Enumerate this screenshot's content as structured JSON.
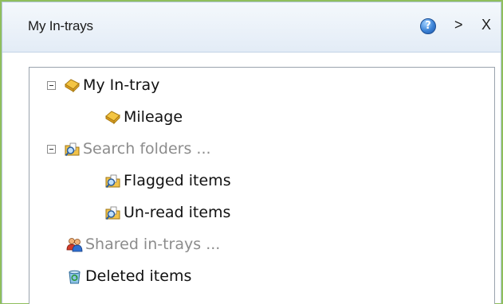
{
  "panel": {
    "title": "My In-trays",
    "help_icon_glyph": "?",
    "collapse_label": ">",
    "close_label": "X"
  },
  "tree": {
    "items": [
      {
        "label": "My In-tray",
        "icon": "tray-icon",
        "expanded": true
      },
      {
        "label": "Mileage",
        "icon": "tray-icon"
      },
      {
        "label": "Search folders ...",
        "icon": "search-folder-icon",
        "expanded": true,
        "dimmed": true
      },
      {
        "label": "Flagged items",
        "icon": "search-folder-icon"
      },
      {
        "label": "Un-read items",
        "icon": "search-folder-icon"
      },
      {
        "label": "Shared in-trays ...",
        "icon": "shared-users-icon",
        "dimmed": true
      },
      {
        "label": "Deleted items",
        "icon": "recycle-bin-icon"
      }
    ]
  },
  "colors": {
    "background_accent": "#8fbf5c",
    "header_bg": "#e3ecf6",
    "dimmed_text": "#8c8c8c",
    "help_icon": "#3b82d6"
  }
}
